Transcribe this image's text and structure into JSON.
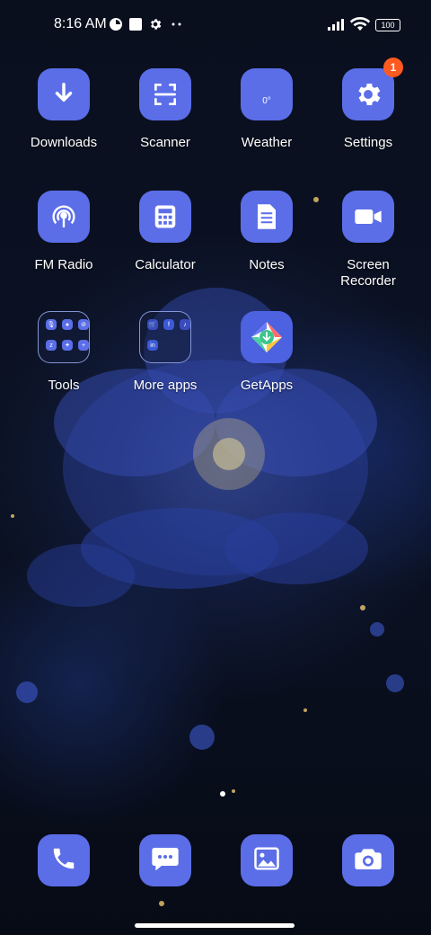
{
  "status_bar": {
    "time": "8:16 AM",
    "battery_level": "100",
    "icons": [
      "app-status-icon",
      "notification-square-icon",
      "settings-gear-icon",
      "more-dots-icon",
      "signal-icon",
      "wifi-icon",
      "battery-icon"
    ]
  },
  "apps": [
    {
      "label": "Downloads",
      "icon": "download-arrow-icon"
    },
    {
      "label": "Scanner",
      "icon": "scanner-icon"
    },
    {
      "label": "Weather",
      "icon": "weather-icon",
      "tile_text": "0°"
    },
    {
      "label": "Settings",
      "icon": "gear-icon",
      "badge": "1"
    },
    {
      "label": "FM Radio",
      "icon": "radio-icon"
    },
    {
      "label": "Calculator",
      "icon": "calculator-icon"
    },
    {
      "label": "Notes",
      "icon": "notes-icon"
    },
    {
      "label": "Screen\nRecorder",
      "icon": "video-camera-icon"
    }
  ],
  "folders": [
    {
      "label": "Tools"
    },
    {
      "label": "More apps"
    }
  ],
  "getapps": {
    "label": "GetApps",
    "icon": "getapps-icon"
  },
  "dock": [
    {
      "name": "phone",
      "icon": "phone-icon"
    },
    {
      "name": "messages",
      "icon": "message-bubble-icon"
    },
    {
      "name": "gallery",
      "icon": "gallery-icon"
    },
    {
      "name": "camera",
      "icon": "camera-icon"
    }
  ],
  "colors": {
    "icon_tile": "#5b6ee8",
    "badge": "#ff5a1f",
    "background": "#0a0f1e"
  }
}
